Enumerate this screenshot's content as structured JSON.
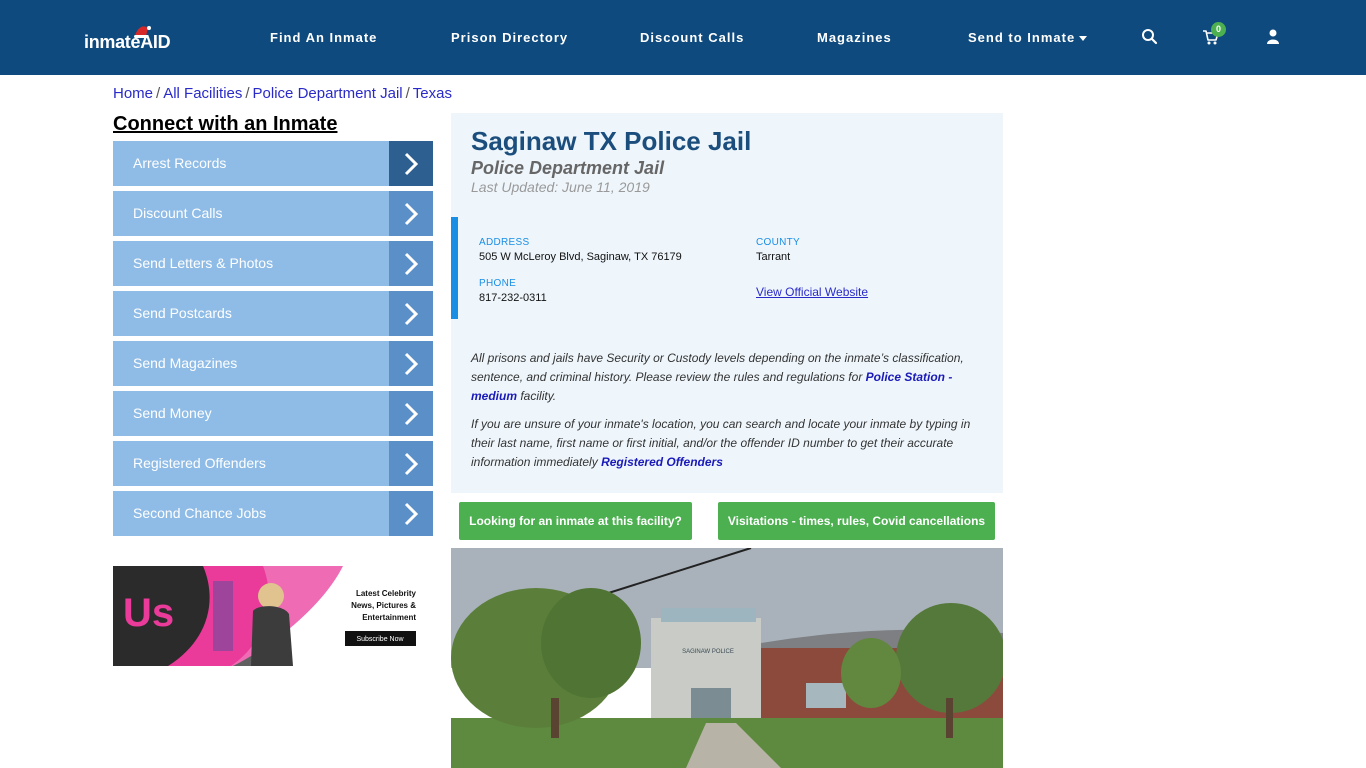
{
  "header": {
    "logo_text": "inmateAID",
    "nav": [
      {
        "label": "Find An Inmate"
      },
      {
        "label": "Prison Directory"
      },
      {
        "label": "Discount Calls"
      },
      {
        "label": "Magazines"
      },
      {
        "label": "Send to Inmate"
      }
    ],
    "cart_count": "0",
    "icons": [
      "search-icon",
      "cart-icon",
      "user-icon"
    ]
  },
  "breadcrumb": [
    {
      "label": "Home"
    },
    {
      "label": "All Facilities"
    },
    {
      "label": "Police Department Jail"
    },
    {
      "label": "Texas"
    }
  ],
  "sidebar": {
    "title": "Connect with an Inmate",
    "items": [
      {
        "label": "Arrest Records"
      },
      {
        "label": "Discount Calls"
      },
      {
        "label": "Send Letters & Photos"
      },
      {
        "label": "Send Postcards"
      },
      {
        "label": "Send Magazines"
      },
      {
        "label": "Send Money"
      },
      {
        "label": "Registered Offenders"
      },
      {
        "label": "Second Chance Jobs"
      }
    ],
    "ad": {
      "brand": "Us",
      "line1": "Latest Celebrity",
      "line2": "News, Pictures &",
      "line3": "Entertainment",
      "cta": "Subscribe Now"
    }
  },
  "facility": {
    "name": "Saginaw TX Police Jail",
    "type": "Police Department Jail",
    "last_updated": "Last Updated: June 11, 2019",
    "address_label": "ADDRESS",
    "address": "505 W McLeroy Blvd, Saginaw, TX 76179",
    "county_label": "COUNTY",
    "county": "Tarrant",
    "phone_label": "PHONE",
    "phone": "817-232-0311",
    "website_link": "View Official Website",
    "para1_a": "All prisons and jails have Security or Custody levels depending on the inmate’s classification, sentence, and criminal history. Please review the rules and regulations for ",
    "para1_link": "Police Station - medium",
    "para1_b": " facility.",
    "para2_a": "If you are unsure of your inmate's location, you can search and locate your inmate by typing in their last name, first name or first initial, and/or the offender ID number to get their accurate information immediately ",
    "para2_link": "Registered Offenders"
  },
  "buttons": {
    "looking": "Looking for an inmate at this facility?",
    "visitations": "Visitations - times, rules, Covid cancellations"
  },
  "photo": {
    "sign_text": "SAGINAW POLICE"
  },
  "colors": {
    "header_bg": "#0e4a7d",
    "sidebar_item": "#8fbce6",
    "sidebar_arrow": "#5b8fc8",
    "accent_blue": "#1a8ee4",
    "green": "#4caf50"
  }
}
